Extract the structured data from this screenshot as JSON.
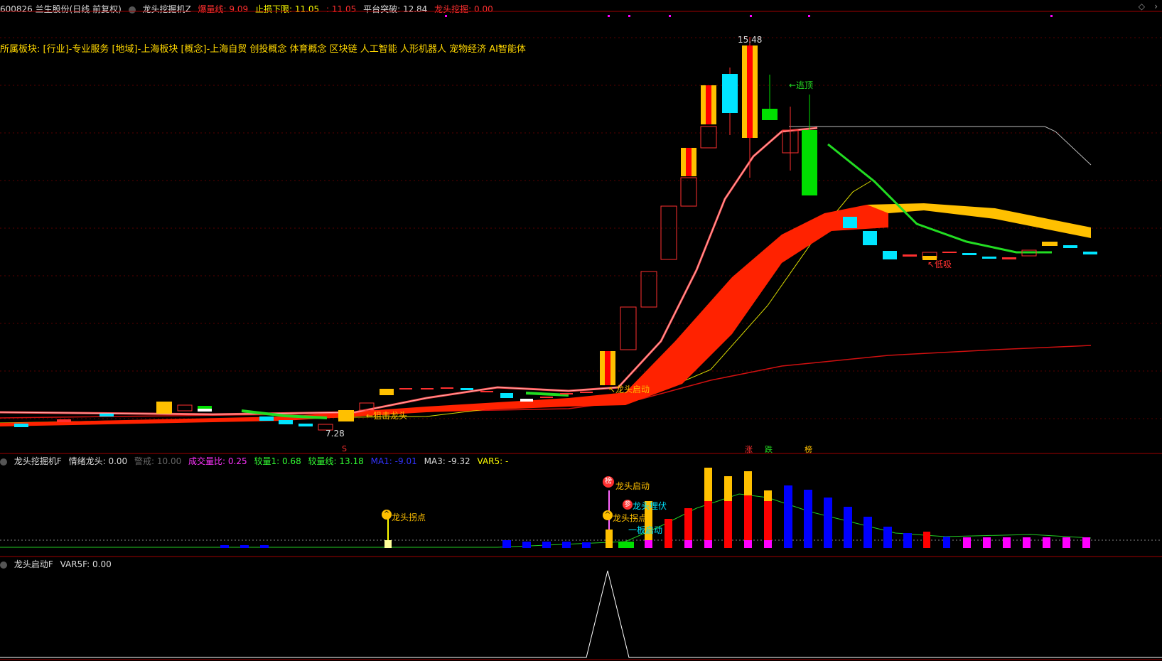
{
  "header": {
    "code_name": "600826 兰生股份(日线 前复权)",
    "indicator_main": "龙头挖掘机Z",
    "items": [
      {
        "label": "爆量线:",
        "value": "9.09",
        "color": "#ff3030"
      },
      {
        "label": "止损下限:",
        "value": "11.05",
        "color": "#ffff00"
      },
      {
        "label": ":",
        "value": "11.05",
        "color": "#ff3030"
      },
      {
        "label": "平台突破:",
        "value": "12.84",
        "color": "#dddddd"
      },
      {
        "label": "龙头挖掘:",
        "value": "0.00",
        "color": "#ff3030"
      }
    ]
  },
  "sector_text": "所属板块: [行业]-专业服务 [地域]-上海板块 [概念]-上海自贸 创投概念 体育概念 区块链 人工智能 人形机器人 宠物经济 AI智能体",
  "annotations": {
    "high": "15.48",
    "low": "7.28",
    "escape_top": "←逃顶",
    "dragon_start": "↖龙头启动",
    "snipe": "←狙击龙头",
    "low_buy": "↖低吸",
    "s_mark": "S",
    "tag_up": "涨",
    "tag_down": "跌",
    "tag_list": "榜"
  },
  "pane2": {
    "name": "龙头挖掘机F",
    "items": [
      {
        "label": "情绪龙头:",
        "value": "0.00",
        "color": "#dddddd"
      },
      {
        "label": "警戒:",
        "value": "10.00",
        "color": "#666666"
      },
      {
        "label": "成交量比:",
        "value": "0.25",
        "color": "#ff33ff"
      },
      {
        "label": "较量1:",
        "value": "0.68",
        "color": "#33ff33"
      },
      {
        "label": "较量线:",
        "value": "13.18",
        "color": "#33ff33"
      },
      {
        "label": "MA1:",
        "value": "-9.01",
        "color": "#3333ff"
      },
      {
        "label": "MA3:",
        "value": "-9.32",
        "color": "#dddddd"
      },
      {
        "label": "VAR5:",
        "value": "-",
        "color": "#ffff00"
      }
    ],
    "labels": {
      "turn_point_1": "龙头拐点",
      "turn_point_2": "龙头拐点",
      "dragon_start": "龙头启动",
      "dragon_hidden": "龙头埋伏",
      "one_board": "一板启动",
      "badge_list": "榜",
      "badge_join": "参"
    }
  },
  "pane3": {
    "name": "龙头启动F",
    "items": [
      {
        "label": "VAR5F:",
        "value": "0.00",
        "color": "#dddddd"
      }
    ]
  },
  "colors": {
    "up": "#ff3030",
    "down": "#00e5ff",
    "gold": "#ffc000",
    "green": "#00e000",
    "blue": "#0000ff",
    "magenta": "#ff00ff"
  }
}
